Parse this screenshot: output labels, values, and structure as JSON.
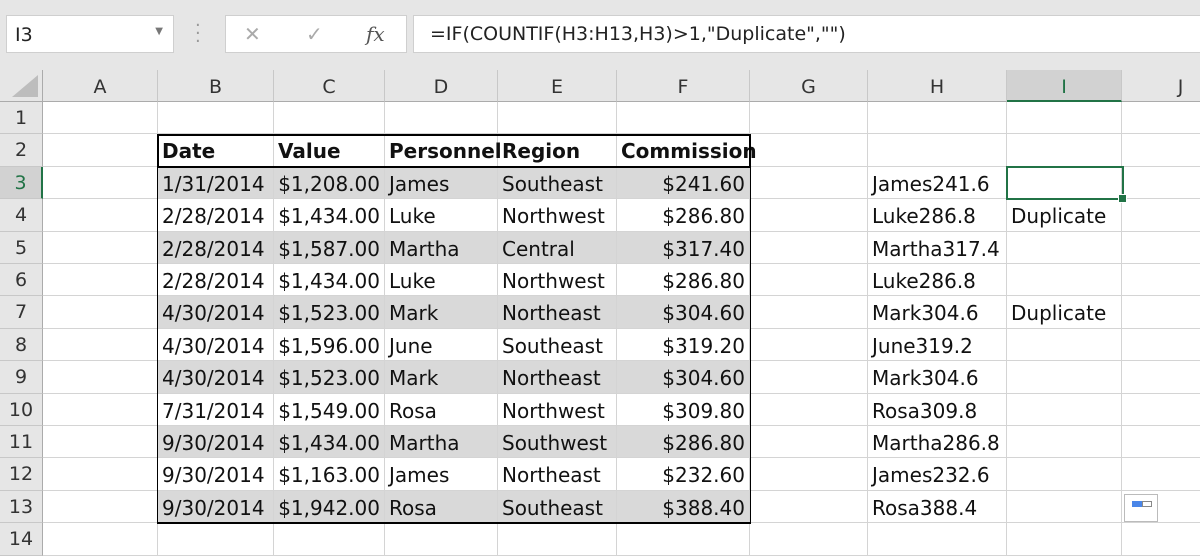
{
  "name_box": "I3",
  "formula": "=IF(COUNTIF(H3:H13,H3)>1,\"Duplicate\",\"\")",
  "columns": [
    "A",
    "B",
    "C",
    "D",
    "E",
    "F",
    "G",
    "H",
    "I",
    "J"
  ],
  "rows": [
    "1",
    "2",
    "3",
    "4",
    "5",
    "6",
    "7",
    "8",
    "9",
    "10",
    "11",
    "12",
    "13",
    "14"
  ],
  "selected_cell": "I3",
  "headers": [
    "Date",
    "Value",
    "Personnel",
    "Region",
    "Commission"
  ],
  "table": [
    [
      "1/31/2014",
      "$1,208.00",
      "James",
      "Southeast",
      "$241.60",
      "James241.6",
      ""
    ],
    [
      "2/28/2014",
      "$1,434.00",
      "Luke",
      "Northwest",
      "$286.80",
      "Luke286.8",
      "Duplicate"
    ],
    [
      "2/28/2014",
      "$1,587.00",
      "Martha",
      "Central",
      "$317.40",
      "Martha317.4",
      ""
    ],
    [
      "2/28/2014",
      "$1,434.00",
      "Luke",
      "Northwest",
      "$286.80",
      "Luke286.8",
      ""
    ],
    [
      "4/30/2014",
      "$1,523.00",
      "Mark",
      "Northeast",
      "$304.60",
      "Mark304.6",
      "Duplicate"
    ],
    [
      "4/30/2014",
      "$1,596.00",
      "June",
      "Southeast",
      "$319.20",
      "June319.2",
      ""
    ],
    [
      "4/30/2014",
      "$1,523.00",
      "Mark",
      "Northeast",
      "$304.60",
      "Mark304.6",
      ""
    ],
    [
      "7/31/2014",
      "$1,549.00",
      "Rosa",
      "Northwest",
      "$309.80",
      "Rosa309.8",
      ""
    ],
    [
      "9/30/2014",
      "$1,434.00",
      "Martha",
      "Southwest",
      "$286.80",
      "Martha286.8",
      ""
    ],
    [
      "9/30/2014",
      "$1,163.00",
      "James",
      "Northeast",
      "$232.60",
      "James232.6",
      ""
    ],
    [
      "9/30/2014",
      "$1,942.00",
      "Rosa",
      "Southeast",
      "$388.40",
      "Rosa388.4",
      ""
    ]
  ],
  "colors": {
    "accent": "#217346",
    "shade": "#d9d9d9"
  }
}
